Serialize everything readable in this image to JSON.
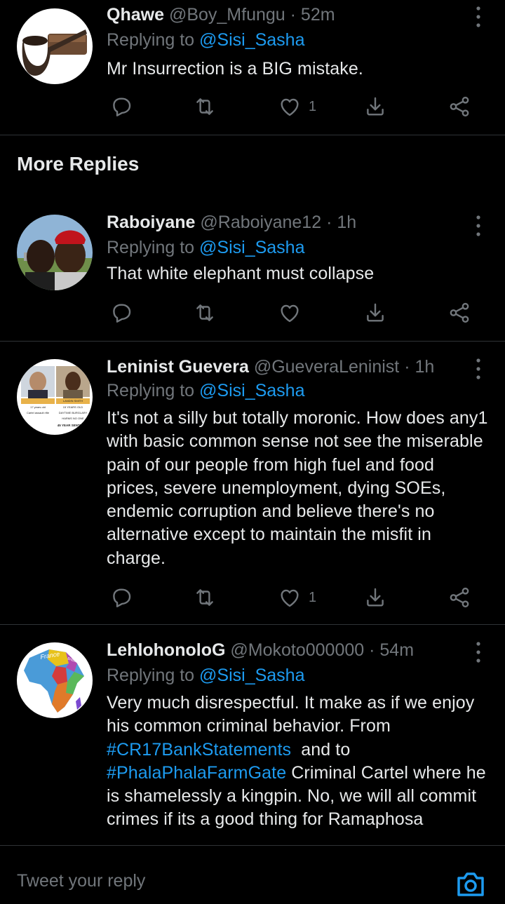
{
  "tweets": [
    {
      "name": "Qhawe",
      "handle": "@Boy_Mfungu",
      "time": "· 52m",
      "replying_prefix": "Replying to ",
      "replying_handle": "@Sisi_Sasha",
      "body": "Mr Insurrection is a BIG mistake.",
      "likes": "1"
    },
    {
      "name": "Raboiyane",
      "handle": "@Raboiyane12",
      "time": "· 1h",
      "replying_prefix": "Replying to ",
      "replying_handle": "@Sisi_Sasha",
      "body": "That white elephant must collapse",
      "likes": ""
    },
    {
      "name": "Leninist Guevera",
      "handle": "@GueveraLeninist",
      "time": "· 1h",
      "replying_prefix": "Replying to ",
      "replying_handle": "@Sisi_Sasha",
      "body": "It's not a silly but totally moronic. How does any1 with basic common sense not see the miserable pain of our people from high fuel and food prices, severe unemployment, dying SOEs, endemic corruption and believe there's no alternative except to maintain the misfit in charge.",
      "likes": "1"
    },
    {
      "name": "LehlohonoloG",
      "handle": "@Mokoto000000",
      "time": "· 54m",
      "replying_prefix": "Replying to ",
      "replying_handle": "@Sisi_Sasha",
      "body_part1": "Very much disrespectful. It make as if we enjoy his common criminal behavior. From ",
      "hashtag1": "#CR17BankStatements",
      "body_part2": "  and to ",
      "hashtag2": "#PhalaPhalaFarmGate",
      "body_part3": " Criminal Cartel where he is shamelessly a kingpin. No, we will all commit crimes if its a good thing for Ramaphosa",
      "likes": ""
    }
  ],
  "section_title": "More Replies",
  "composer": {
    "placeholder": "Tweet your reply"
  },
  "avatar_text": {
    "leninist_left_caption": "17 years old",
    "leninist_right_caption": "15 YEARS OLD",
    "leninist_right_name": "LANDIN SMITH",
    "leninist_line2_left": "Cartel assault rifle",
    "leninist_line2_right": "DAYTIME BURGLARY",
    "leninist_line3_right": "HARMS NO ONE",
    "leninist_sentence": "45 YEAR SENTENCE",
    "map_label_1": "France",
    "map_label_2": "Britain"
  },
  "icons": [
    "reply-icon",
    "retweet-icon",
    "heart-icon",
    "share-icon",
    "share-nodes-icon",
    "more-vertical-icon",
    "camera-icon"
  ],
  "colors": {
    "accent": "#1d9bf0",
    "muted": "#71767b",
    "text": "#e7e9ea",
    "divider": "#2f3336"
  }
}
